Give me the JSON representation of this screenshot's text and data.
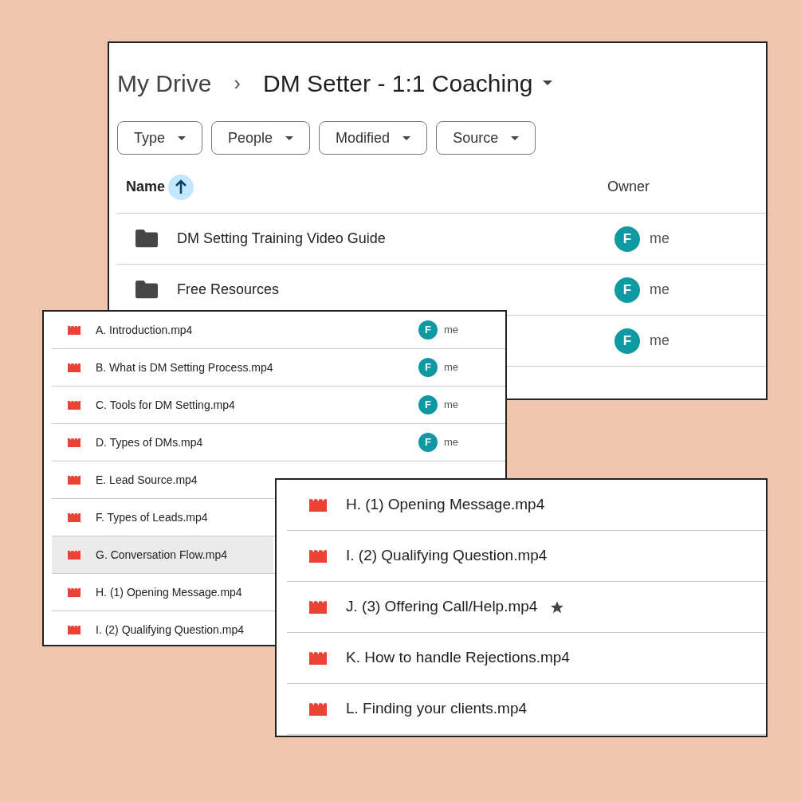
{
  "drive_window": {
    "breadcrumb": {
      "root": "My Drive",
      "separator": "›",
      "current": "DM Setter - 1:1 Coaching"
    },
    "filters": [
      {
        "label": "Type"
      },
      {
        "label": "People"
      },
      {
        "label": "Modified"
      },
      {
        "label": "Source"
      }
    ],
    "columns": [
      "Name",
      "Owner"
    ],
    "rows": [
      {
        "kind": "folder",
        "name": "DM Setting Training Video Guide",
        "owner": {
          "initial": "F",
          "name": "me"
        }
      },
      {
        "kind": "folder",
        "name": "Free Resources",
        "owner": {
          "initial": "F",
          "name": "me"
        }
      },
      {
        "owner": {
          "initial": "F",
          "name": "me"
        }
      }
    ]
  },
  "video_list_window": {
    "rows": [
      {
        "kind": "video",
        "name": "A. Introduction.mp4",
        "selected": false,
        "owner": {
          "initial": "F",
          "name": "me"
        }
      },
      {
        "kind": "video",
        "name": "B. What is DM Setting Process.mp4",
        "selected": false,
        "owner": {
          "initial": "F",
          "name": "me"
        }
      },
      {
        "kind": "video",
        "name": "C. Tools for DM Setting.mp4",
        "selected": false,
        "owner": {
          "initial": "F",
          "name": "me"
        }
      },
      {
        "kind": "video",
        "name": "D. Types of DMs.mp4",
        "selected": false,
        "owner": {
          "initial": "F",
          "name": "me"
        }
      },
      {
        "kind": "video",
        "name": "E. Lead Source.mp4",
        "selected": false
      },
      {
        "kind": "video",
        "name": "F. Types of Leads.mp4",
        "selected": false
      },
      {
        "kind": "video",
        "name": "G. Conversation Flow.mp4",
        "selected": true
      },
      {
        "kind": "video",
        "name": "H. (1) Opening Message.mp4",
        "selected": false
      },
      {
        "kind": "video",
        "name": "I. (2) Qualifying Question.mp4",
        "selected": false
      }
    ]
  },
  "video_detail_window": {
    "rows": [
      {
        "kind": "video",
        "name": "H. (1) Opening Message.mp4",
        "starred": false
      },
      {
        "kind": "video",
        "name": "I. (2) Qualifying Question.mp4",
        "starred": false
      },
      {
        "kind": "video",
        "name": "J. (3) Offering Call/Help.mp4",
        "starred": true
      },
      {
        "kind": "video",
        "name": "K. How to handle Rejections.mp4",
        "starred": false
      },
      {
        "kind": "video",
        "name": "L. Finding your clients.mp4",
        "starred": false
      }
    ]
  }
}
